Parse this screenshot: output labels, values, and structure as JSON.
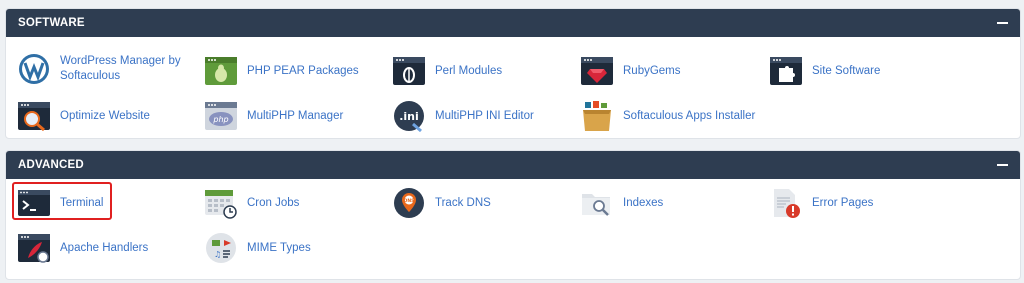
{
  "software": {
    "title": "SOFTWARE",
    "items": [
      {
        "label": "WordPress Manager by Softaculous",
        "icon": "wordpress-icon"
      },
      {
        "label": "PHP PEAR Packages",
        "icon": "pear-icon"
      },
      {
        "label": "Perl Modules",
        "icon": "perl-icon"
      },
      {
        "label": "RubyGems",
        "icon": "ruby-icon"
      },
      {
        "label": "Site Software",
        "icon": "puzzle-icon"
      },
      {
        "label": "Optimize Website",
        "icon": "optimize-icon"
      },
      {
        "label": "MultiPHP Manager",
        "icon": "php-icon"
      },
      {
        "label": "MultiPHP INI Editor",
        "icon": "ini-icon"
      },
      {
        "label": "Softaculous Apps Installer",
        "icon": "softaculous-icon"
      }
    ]
  },
  "advanced": {
    "title": "ADVANCED",
    "items": [
      {
        "label": "Terminal",
        "icon": "terminal-icon",
        "highlighted": true
      },
      {
        "label": "Cron Jobs",
        "icon": "calendar-clock-icon"
      },
      {
        "label": "Track DNS",
        "icon": "dns-pin-icon"
      },
      {
        "label": "Indexes",
        "icon": "folder-search-icon"
      },
      {
        "label": "Error Pages",
        "icon": "error-document-icon"
      },
      {
        "label": "Apache Handlers",
        "icon": "apache-feather-icon"
      },
      {
        "label": "MIME Types",
        "icon": "mime-media-icon"
      }
    ]
  },
  "colors": {
    "header_bg": "#2e3d51",
    "link": "#3b73c6",
    "highlight": "#e02020"
  }
}
